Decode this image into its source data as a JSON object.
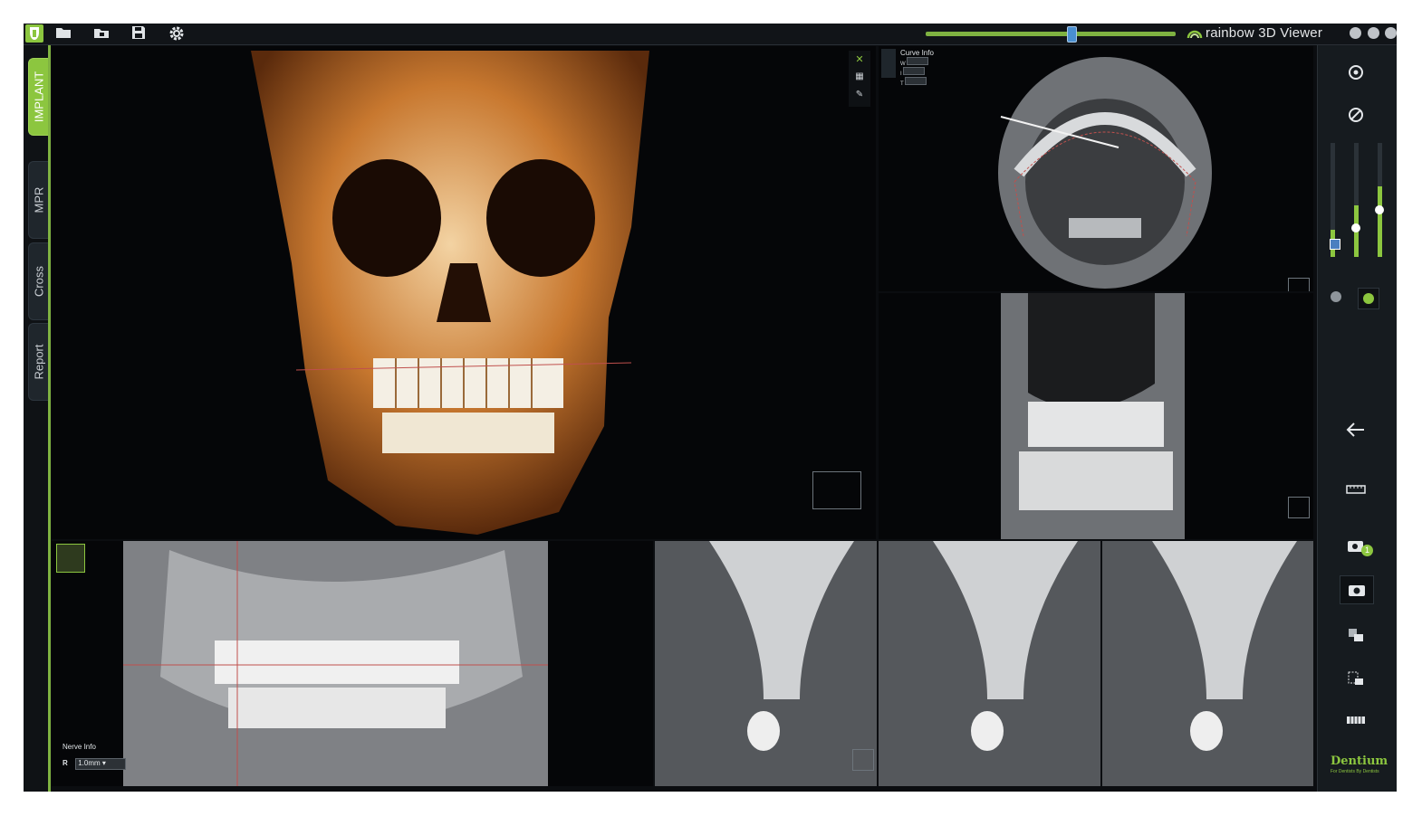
{
  "app": {
    "title": "rainbow 3D Viewer",
    "accent_color": "#8cc63f",
    "zoom_slider": {
      "value_fraction": 0.58
    }
  },
  "toolbar": {
    "icons": [
      "app-logo-icon",
      "open-folder-icon",
      "open-study-icon",
      "save-icon",
      "settings-icon"
    ]
  },
  "window_controls": [
    "minimize-icon",
    "restore-icon",
    "close-icon"
  ],
  "tabs": [
    {
      "label": "IMPLANT",
      "active": true
    },
    {
      "label": "MPR",
      "active": false
    },
    {
      "label": "Cross",
      "active": false
    },
    {
      "label": "Report",
      "active": false
    }
  ],
  "curve_info": {
    "title": "Curve Info",
    "rows": [
      {
        "label": "W",
        "value": ""
      },
      {
        "label": "I",
        "value": ""
      },
      {
        "label": "T",
        "value": ""
      }
    ]
  },
  "nerve_info": {
    "title": "Nerve Info",
    "side_label": "R",
    "value": "1.0mm"
  },
  "right_toolbar": {
    "icons": [
      "rotate-view-icon",
      "reset-view-icon",
      "back-arrow-icon",
      "ruler-2d-icon",
      "capture-count-icon",
      "camera-icon",
      "capture-region-icon",
      "capture-select-icon",
      "film-strip-icon"
    ],
    "capture_count": "1",
    "sliders": [
      {
        "name": "level",
        "fraction": 0.24
      },
      {
        "name": "contrast",
        "fraction": 0.45
      },
      {
        "name": "brightness",
        "fraction": 0.62
      }
    ],
    "brand": "Dentium",
    "brand_tagline": "For Dentists By Dentists"
  }
}
